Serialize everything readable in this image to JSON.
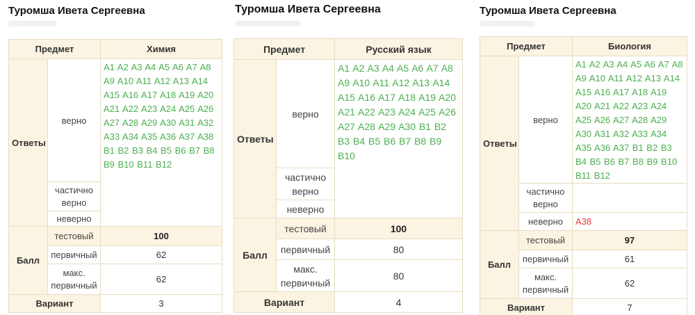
{
  "labels": {
    "subject": "Предмет",
    "answers": "Ответы",
    "correct": "верно",
    "partial_1": "частично",
    "partial_2": "верно",
    "wrong": "неверно",
    "score": "Балл",
    "test": "тестовый",
    "primary": "первичный",
    "max_primary_1": "макс.",
    "max_primary_2": "первичный",
    "variant": "Вариант"
  },
  "results": [
    {
      "student": "Туромша Ивета Сергеевна",
      "subject": "Химия",
      "correct": "A1 A2 A3 A4 A5 A6 A7 A8 A9 A10 A11 A12 A13 A14 A15 A16 A17 A18 A19 A20 A21 A22 A23 A24 A25 A26 A27 A28 A29 A30 A31 A32 A33 A34 A35 A36 A37 A38 B1 B2 B3 B4 B5 B6 B7 B8 B9 B10 B11 B12",
      "partial": "",
      "wrong": "",
      "test_score": "100",
      "primary_score": "62",
      "max_primary": "62",
      "variant": "3"
    },
    {
      "student": "Туромша Ивета Сергеевна",
      "subject": "Русский язык",
      "correct": "A1 A2 A3 A4 A5 A6 A7 A8 A9 A10 A11 A12 A13 A14 A15 A16 A17 A18 A19 A20 A21 A22 A23 A24 A25 A26 A27 A28 A29 A30 B1 B2 B3 B4 B5 B6 B7 B8 B9 B10",
      "partial": "",
      "wrong": "",
      "test_score": "100",
      "primary_score": "80",
      "max_primary": "80",
      "variant": "4"
    },
    {
      "student": "Туромша Ивета Сергеевна",
      "subject": "Биология",
      "correct": "A1 A2 A3 A4 A5 A6 A7 A8 A9 A10 A11 A12 A13 A14 A15 A16 A17 A18 A19 A20 A21 A22 A23 A24 A25 A26 A27 A28 A29 A30 A31 A32 A33 A34 A35 A36 A37 B1 B2 B3 B4 B5 B6 B7 B8 B9 B10 B11 B12",
      "partial": "",
      "wrong": "A38",
      "test_score": "97",
      "primary_score": "61",
      "max_primary": "62",
      "variant": "7"
    }
  ],
  "colors": {
    "header_bg": "#fbf4e2",
    "border": "#e6dcc2",
    "correct": "#4caf50",
    "wrong": "#e53935"
  }
}
